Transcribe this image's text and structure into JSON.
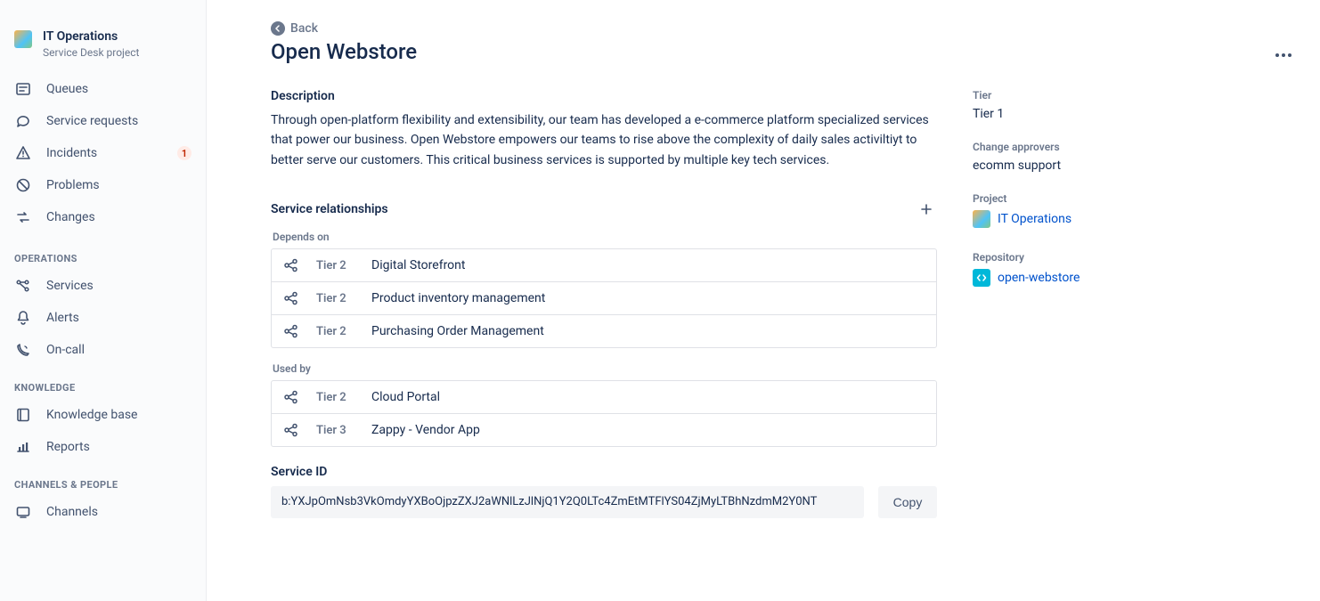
{
  "project": {
    "name": "IT Operations",
    "subtitle": "Service Desk project"
  },
  "nav": {
    "primary": [
      {
        "label": "Queues",
        "icon": "queues",
        "badge": null
      },
      {
        "label": "Service requests",
        "icon": "comment",
        "badge": null
      },
      {
        "label": "Incidents",
        "icon": "incident",
        "badge": "1"
      },
      {
        "label": "Problems",
        "icon": "problem",
        "badge": null
      },
      {
        "label": "Changes",
        "icon": "changes",
        "badge": null
      }
    ],
    "groups": [
      {
        "label": "OPERATIONS",
        "items": [
          {
            "label": "Services",
            "icon": "services"
          },
          {
            "label": "Alerts",
            "icon": "alerts"
          },
          {
            "label": "On-call",
            "icon": "oncall"
          }
        ]
      },
      {
        "label": "KNOWLEDGE",
        "items": [
          {
            "label": "Knowledge base",
            "icon": "kb"
          },
          {
            "label": "Reports",
            "icon": "reports"
          }
        ]
      },
      {
        "label": "CHANNELS & PEOPLE",
        "items": [
          {
            "label": "Channels",
            "icon": "channels"
          }
        ]
      }
    ]
  },
  "back_label": "Back",
  "title": "Open Webstore",
  "description": {
    "heading": "Description",
    "body": "Through open-platform flexibility and extensibility, our team has developed a e-commerce platform specialized services that power our business. Open Webstore empowers our teams to rise above the complexity of daily sales activiltiyt to better serve our customers. This critical business services is supported by multiple key tech services."
  },
  "relationships": {
    "heading": "Service relationships",
    "groups": [
      {
        "label": "Depends on",
        "rows": [
          {
            "tier": "Tier 2",
            "name": "Digital Storefront"
          },
          {
            "tier": "Tier 2",
            "name": "Product inventory management"
          },
          {
            "tier": "Tier 2",
            "name": "Purchasing Order Management"
          }
        ]
      },
      {
        "label": "Used by",
        "rows": [
          {
            "tier": "Tier 2",
            "name": "Cloud Portal"
          },
          {
            "tier": "Tier 3",
            "name": "Zappy - Vendor App"
          }
        ]
      }
    ]
  },
  "service_id": {
    "heading": "Service ID",
    "value": "b:YXJpOmNsb3VkOmdyYXBoOjpzZXJ2aWNlLzJlNjQ1Y2Q0LTc4ZmEtMTFlYS04ZjMyLTBhNzdmM2Y0NT",
    "copy_label": "Copy"
  },
  "meta": {
    "tier": {
      "label": "Tier",
      "value": "Tier 1"
    },
    "change_approvers": {
      "label": "Change approvers",
      "value": "ecomm support"
    },
    "project_link": {
      "label": "Project",
      "value": "IT Operations"
    },
    "repository": {
      "label": "Repository",
      "value": "open-webstore"
    }
  }
}
